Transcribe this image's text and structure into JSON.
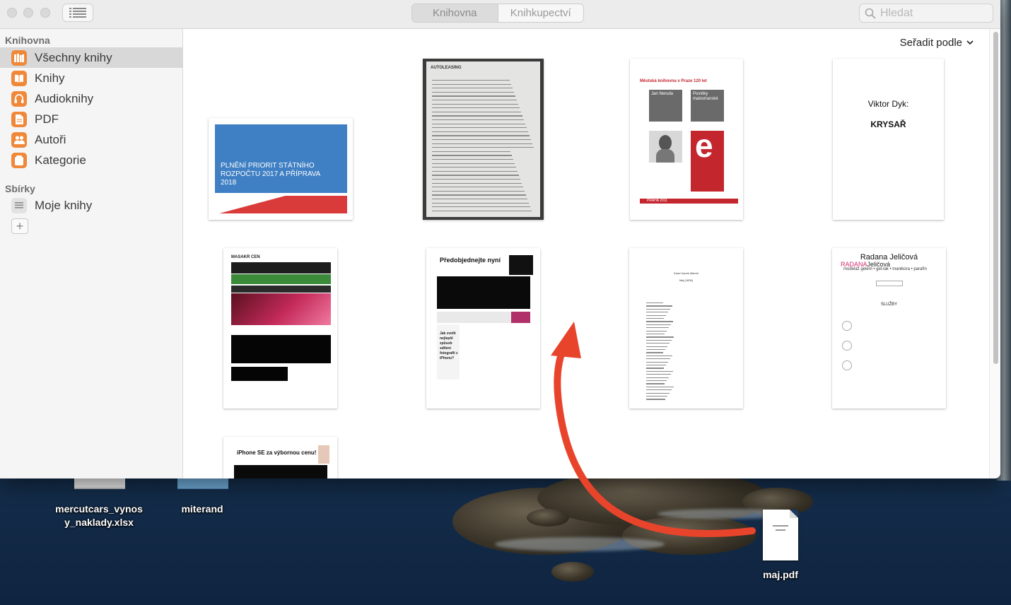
{
  "window": {
    "tabs": [
      "Knihovna",
      "Knihkupectví"
    ],
    "search_placeholder": "Hledat",
    "sort_label": "Seřadit podle"
  },
  "sidebar": {
    "library_heading": "Knihovna",
    "library_items": [
      {
        "label": "Všechny knihy",
        "icon": "all-books-icon"
      },
      {
        "label": "Knihy",
        "icon": "book-icon"
      },
      {
        "label": "Audioknihy",
        "icon": "headphones-icon"
      },
      {
        "label": "PDF",
        "icon": "pdf-icon"
      },
      {
        "label": "Autoři",
        "icon": "authors-icon"
      },
      {
        "label": "Kategorie",
        "icon": "category-icon"
      }
    ],
    "collections_heading": "Sbírky",
    "collection_items": [
      {
        "label": "Moje knihy",
        "icon": "list-icon"
      }
    ],
    "add_symbol": "+"
  },
  "books": {
    "b1": {
      "title": "PLNĚNÍ PRIORIT STÁTNÍHO ROZPOČTU 2017 A PŘÍPRAVA 2018"
    },
    "b2": {
      "header": "AUTOLEASING"
    },
    "b3": {
      "header": "Městská knihovna v Praze 120 let",
      "author": "Jan Neruda",
      "work": "Povídky malostranské",
      "footer": "PRAHA 2011",
      "logo_letter": "e"
    },
    "b4": {
      "author": "Viktor Dyk:",
      "title": "KRYSAŘ"
    },
    "b5": {
      "header": "MASAKR CEN"
    },
    "b6": {
      "header": "Předobjednejte nyní",
      "body": "Jak zvolit nejlepší způsob sdílení fotografií z iPhonu?"
    },
    "b7": {
      "author": "Karel Hynek Mácha",
      "title": "Máj (1836)"
    },
    "b8": {
      "name": "Radana Jeličová",
      "brand": "RADANA",
      "brand2": "Jeličová",
      "tagline": "modeláž gelem • gel-lak • manikúra • parafín",
      "section": "SLUŽBY"
    },
    "b9": {
      "header": "iPhone SE za výbornou cenu!"
    }
  },
  "desktop": {
    "files": [
      {
        "label": "mercutcars_vynos y_naklady.xlsx"
      },
      {
        "label": "miterand"
      },
      {
        "label": "maj.pdf"
      }
    ]
  },
  "colors": {
    "accent_orange": "#f0883a",
    "arrow_red": "#e8442c",
    "selected_bg": "#d8d8d8"
  }
}
